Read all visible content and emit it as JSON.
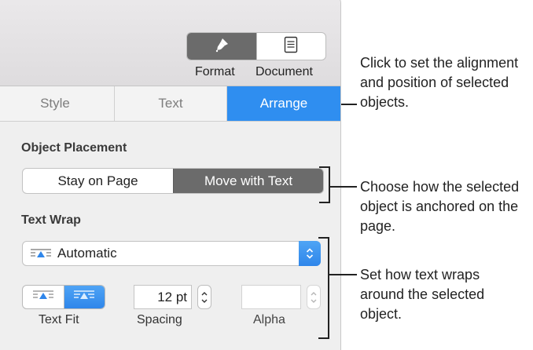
{
  "toolbar": {
    "format_label": "Format",
    "document_label": "Document",
    "format_icon": "paintbrush-icon",
    "document_icon": "document-icon"
  },
  "tabs": [
    {
      "label": "Style",
      "active": false
    },
    {
      "label": "Text",
      "active": false
    },
    {
      "label": "Arrange",
      "active": true
    }
  ],
  "object_placement": {
    "title": "Object Placement",
    "options": [
      "Stay on Page",
      "Move with Text"
    ],
    "selected": "Move with Text"
  },
  "text_wrap": {
    "title": "Text Wrap",
    "selected": "Automatic",
    "icon": "text-wrap-icon",
    "text_fit_label": "Text Fit",
    "spacing_label": "Spacing",
    "spacing_value": "12 pt",
    "alpha_label": "Alpha",
    "alpha_value": ""
  },
  "callouts": {
    "arrange": "Click to set the alignment and position of selected objects.",
    "placement": "Choose how the selected object is anchored on the page.",
    "wrap": "Set how text wraps around the selected object."
  },
  "colors": {
    "accent": "#2f8ef0",
    "selected_segment": "#6b6b6b",
    "panel_bg": "#efefef"
  }
}
